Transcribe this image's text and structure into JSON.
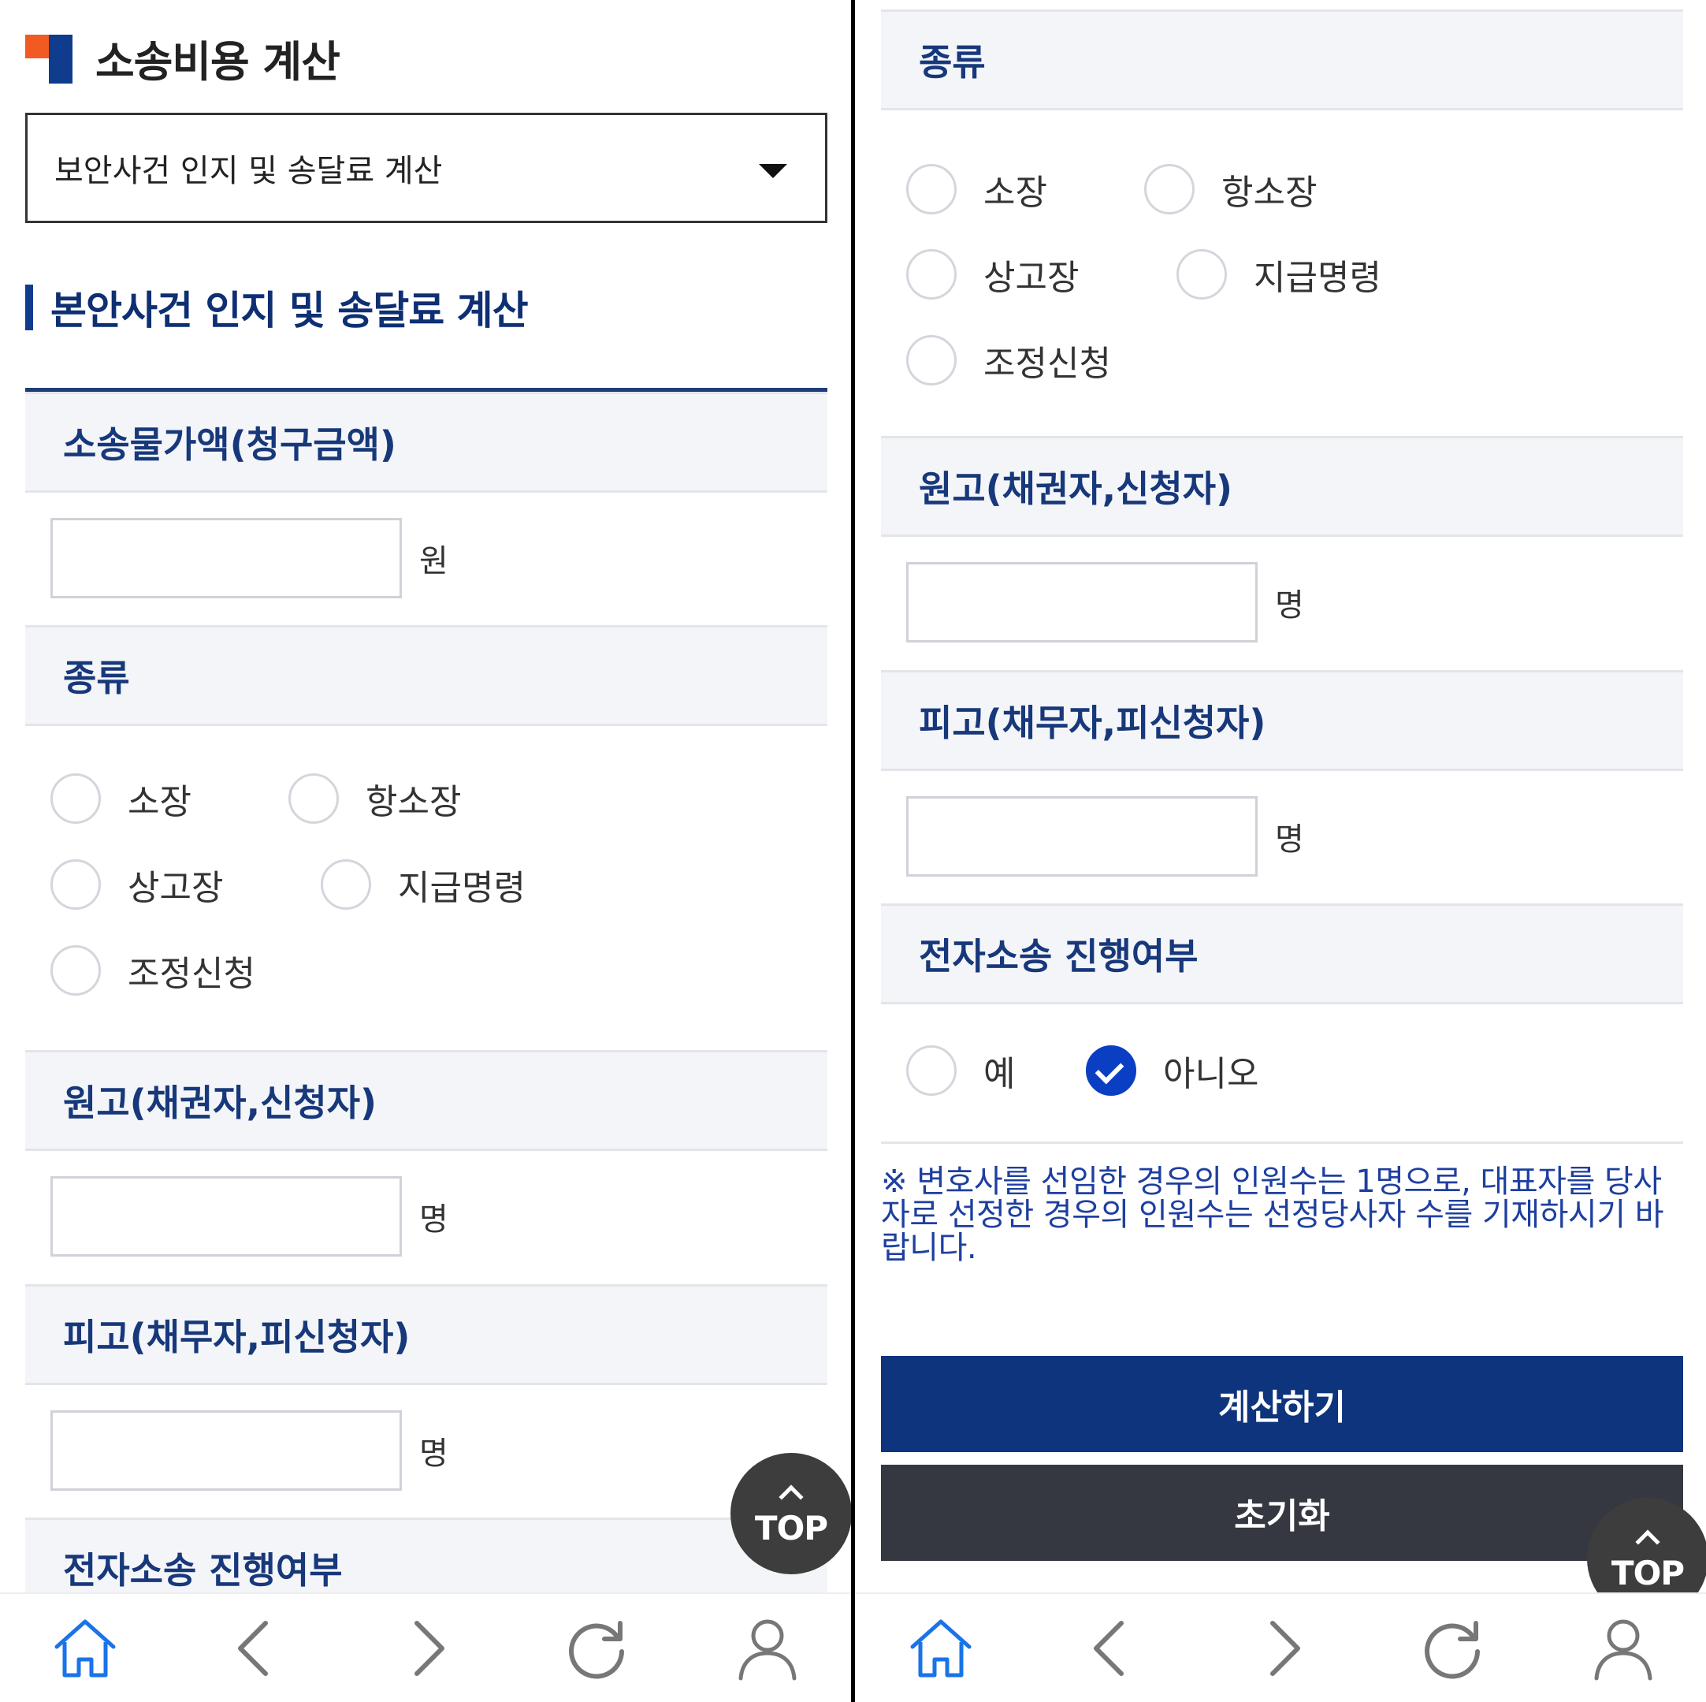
{
  "left": {
    "title": "소송비용 계산",
    "select_value": "보안사건 인지 및 송달료 계산",
    "section_title": "본안사건 인지 및 송달료 계산",
    "fields": {
      "amount_label": "소송물가액(청구금액)",
      "amount_unit": "원",
      "type_label": "종류",
      "plaintiff_label": "원고(채권자,신청자)",
      "plaintiff_unit": "명",
      "defendant_label": "피고(채무자,피신청자)",
      "defendant_unit": "명",
      "electronic_label": "전자소송 진행여부"
    },
    "type_options": [
      "소장",
      "항소장",
      "상고장",
      "지급명령",
      "조정신청"
    ],
    "top_label": "TOP"
  },
  "right": {
    "fields": {
      "type_label": "종류",
      "plaintiff_label": "원고(채권자,신청자)",
      "plaintiff_unit": "명",
      "defendant_label": "피고(채무자,피신청자)",
      "defendant_unit": "명",
      "electronic_label": "전자소송 진행여부"
    },
    "type_options": [
      "소장",
      "항소장",
      "상고장",
      "지급명령",
      "조정신청"
    ],
    "electronic_options": [
      "예",
      "아니오"
    ],
    "electronic_selected": "아니오",
    "notice": "※ 변호사를 선임한 경우의 인원수는 1명으로, 대표자를 당사자로 선정한 경우의 인원수는 선정당사자 수를 기재하시기 바랍니다.",
    "calculate_label": "계산하기",
    "reset_label": "초기화",
    "top_label": "TOP"
  },
  "nav_icons": [
    "home-icon",
    "back-icon",
    "forward-icon",
    "refresh-icon",
    "profile-icon"
  ],
  "colors": {
    "brand_navy": "#0e347e",
    "accent_orange": "#f15a22",
    "reset_dark": "#353840",
    "check_blue": "#0a3fc4",
    "nav_active": "#1a73e8"
  }
}
